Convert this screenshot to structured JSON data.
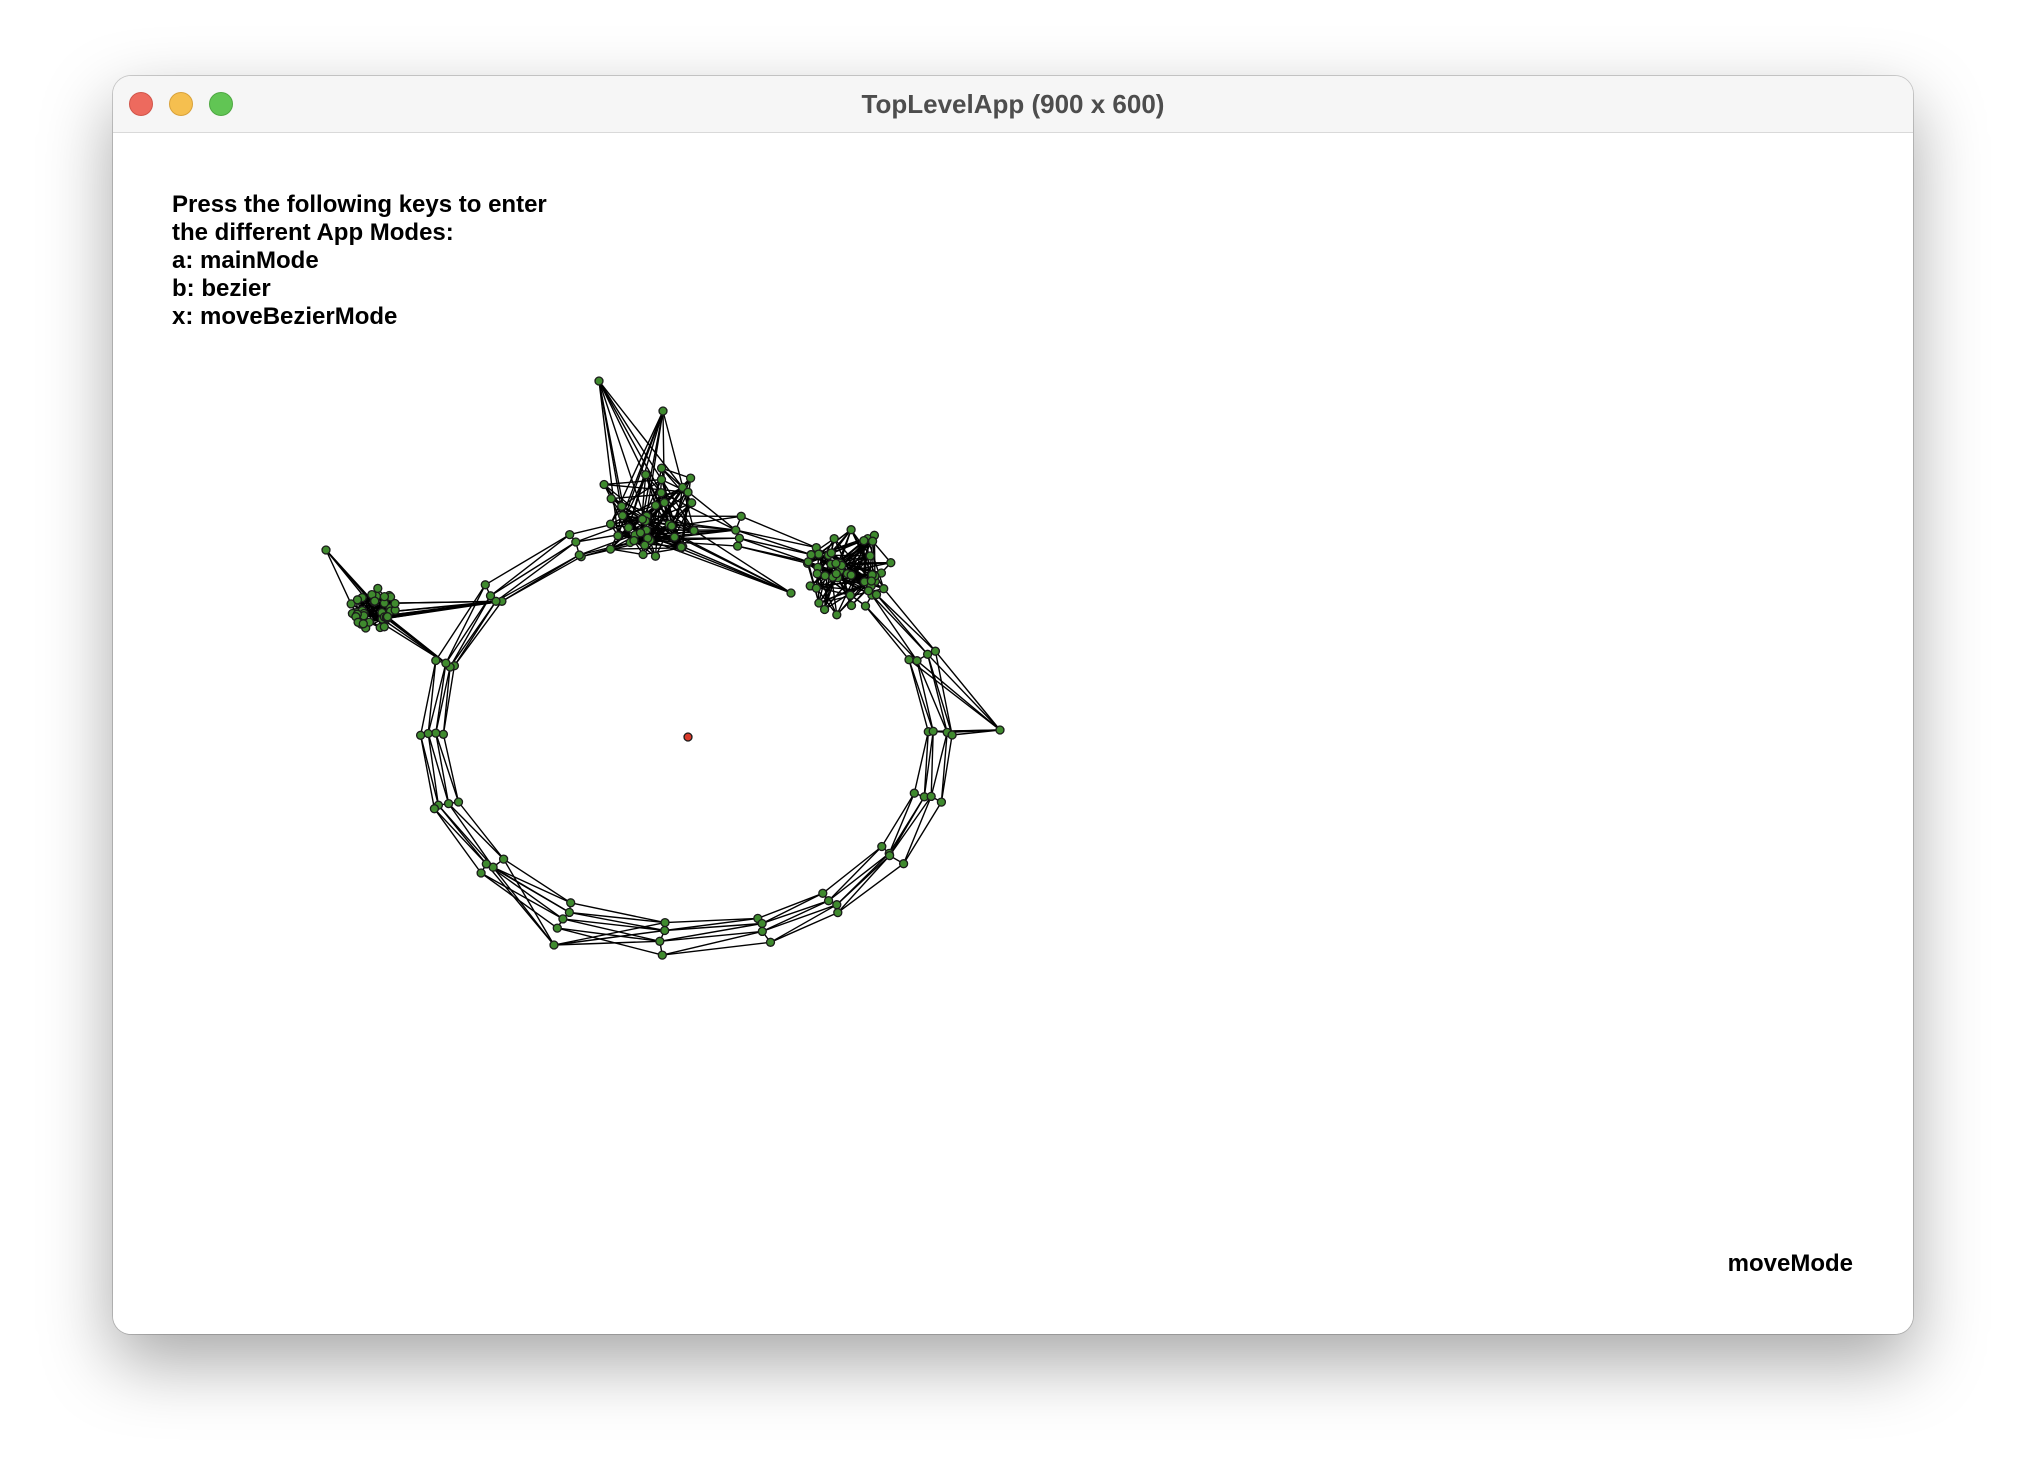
{
  "window": {
    "title": "TopLevelApp (900 x 600)"
  },
  "instructions": {
    "lines": [
      "Press the following keys to enter",
      "the different App Modes:",
      "a: mainMode",
      "b: bezier",
      "x: moveBezierMode"
    ]
  },
  "status": {
    "mode": "moveMode"
  },
  "colors": {
    "node_fill": "#3f8a2e",
    "node_stroke": "#1a1a1a",
    "edge": "#000000",
    "center_fill": "#d93a2b",
    "close_button": "#ed6a5e",
    "minimize_button": "#f5bf4f",
    "zoom_button": "#61c554"
  },
  "icons": {
    "close": "close-icon",
    "minimize": "minimize-icon",
    "zoom": "zoom-icon"
  }
}
